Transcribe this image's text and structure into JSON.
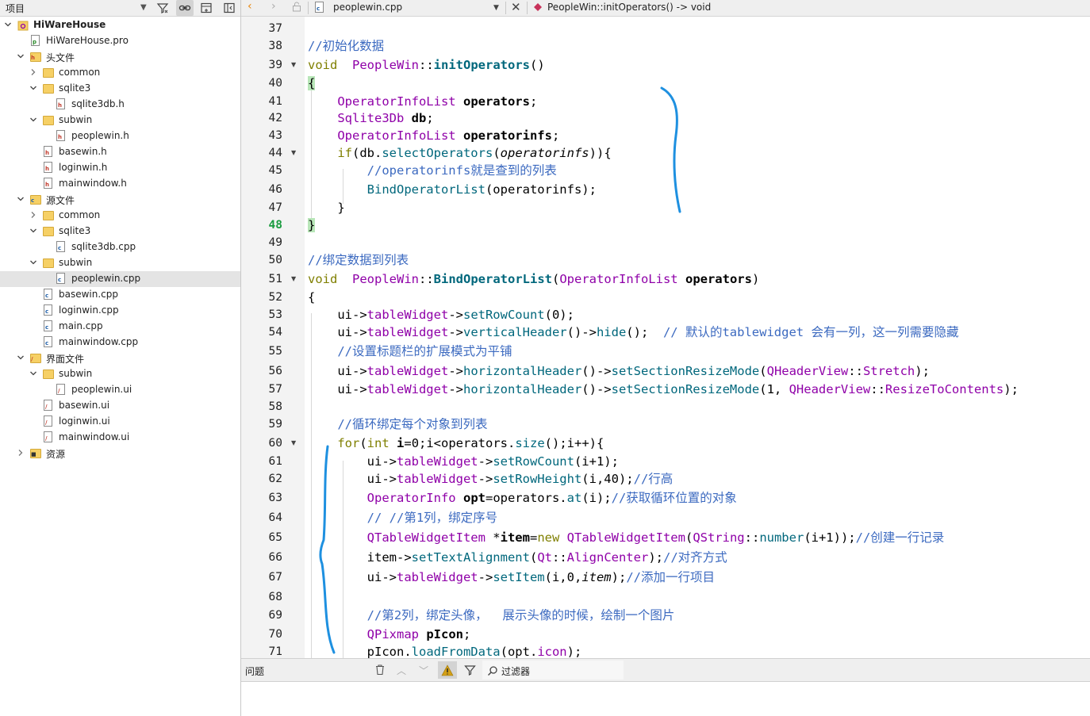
{
  "project_pane": {
    "combo_label": "项目",
    "tree": [
      {
        "label": "HiWareHouse",
        "depth": 0,
        "expander": "expanded",
        "icon": "project-icon",
        "root": true
      },
      {
        "label": "HiWareHouse.pro",
        "depth": 1,
        "expander": "none",
        "icon": "pro-file-icon"
      },
      {
        "label": "头文件",
        "depth": 1,
        "expander": "expanded",
        "icon": "headers-folder-icon"
      },
      {
        "label": "common",
        "depth": 2,
        "expander": "collapsed",
        "icon": "folder-icon"
      },
      {
        "label": "sqlite3",
        "depth": 2,
        "expander": "expanded",
        "icon": "folder-icon"
      },
      {
        "label": "sqlite3db.h",
        "depth": 3,
        "expander": "none",
        "icon": "header-file-icon"
      },
      {
        "label": "subwin",
        "depth": 2,
        "expander": "expanded",
        "icon": "folder-icon"
      },
      {
        "label": "peoplewin.h",
        "depth": 3,
        "expander": "none",
        "icon": "header-file-icon"
      },
      {
        "label": "basewin.h",
        "depth": 2,
        "expander": "none",
        "icon": "header-file-icon"
      },
      {
        "label": "loginwin.h",
        "depth": 2,
        "expander": "none",
        "icon": "header-file-icon"
      },
      {
        "label": "mainwindow.h",
        "depth": 2,
        "expander": "none",
        "icon": "header-file-icon"
      },
      {
        "label": "源文件",
        "depth": 1,
        "expander": "expanded",
        "icon": "sources-folder-icon"
      },
      {
        "label": "common",
        "depth": 2,
        "expander": "collapsed",
        "icon": "folder-icon"
      },
      {
        "label": "sqlite3",
        "depth": 2,
        "expander": "expanded",
        "icon": "folder-icon"
      },
      {
        "label": "sqlite3db.cpp",
        "depth": 3,
        "expander": "none",
        "icon": "cpp-file-icon"
      },
      {
        "label": "subwin",
        "depth": 2,
        "expander": "expanded",
        "icon": "folder-icon"
      },
      {
        "label": "peoplewin.cpp",
        "depth": 3,
        "expander": "none",
        "icon": "cpp-file-icon",
        "selected": true
      },
      {
        "label": "basewin.cpp",
        "depth": 2,
        "expander": "none",
        "icon": "cpp-file-icon"
      },
      {
        "label": "loginwin.cpp",
        "depth": 2,
        "expander": "none",
        "icon": "cpp-file-icon"
      },
      {
        "label": "main.cpp",
        "depth": 2,
        "expander": "none",
        "icon": "cpp-file-icon"
      },
      {
        "label": "mainwindow.cpp",
        "depth": 2,
        "expander": "none",
        "icon": "cpp-file-icon"
      },
      {
        "label": "界面文件",
        "depth": 1,
        "expander": "expanded",
        "icon": "forms-folder-icon"
      },
      {
        "label": "subwin",
        "depth": 2,
        "expander": "expanded",
        "icon": "folder-icon"
      },
      {
        "label": "peoplewin.ui",
        "depth": 3,
        "expander": "none",
        "icon": "ui-file-icon"
      },
      {
        "label": "basewin.ui",
        "depth": 2,
        "expander": "none",
        "icon": "ui-file-icon"
      },
      {
        "label": "loginwin.ui",
        "depth": 2,
        "expander": "none",
        "icon": "ui-file-icon"
      },
      {
        "label": "mainwindow.ui",
        "depth": 2,
        "expander": "none",
        "icon": "ui-file-icon"
      },
      {
        "label": "资源",
        "depth": 1,
        "expander": "collapsed",
        "icon": "resources-folder-icon"
      }
    ]
  },
  "editor_toolbar": {
    "file_name": "peoplewin.cpp",
    "symbol": "PeopleWin::initOperators() -> void"
  },
  "editor": {
    "current_line": 48,
    "lines": [
      {
        "n": 37,
        "tokens": []
      },
      {
        "n": 38,
        "tokens": [
          [
            "cm",
            "//初始化数据"
          ]
        ]
      },
      {
        "n": 39,
        "fold": true,
        "tokens": [
          [
            "kw",
            "void"
          ],
          [
            "",
            "  "
          ],
          [
            "ty",
            "PeopleWin"
          ],
          [
            "",
            "::"
          ],
          [
            "fnb",
            "initOperators"
          ],
          [
            "",
            "()"
          ]
        ]
      },
      {
        "n": 40,
        "tokens": [
          [
            "hl",
            "{"
          ]
        ]
      },
      {
        "n": 41,
        "tokens": [
          [
            "",
            "    "
          ],
          [
            "ty",
            "OperatorInfoList"
          ],
          [
            "",
            " "
          ],
          [
            "bd",
            "operators"
          ],
          [
            "",
            ";"
          ]
        ]
      },
      {
        "n": 42,
        "tokens": [
          [
            "",
            "    "
          ],
          [
            "ty",
            "Sqlite3Db"
          ],
          [
            "",
            " "
          ],
          [
            "bd",
            "db"
          ],
          [
            "",
            ";"
          ]
        ]
      },
      {
        "n": 43,
        "tokens": [
          [
            "",
            "    "
          ],
          [
            "ty",
            "OperatorInfoList"
          ],
          [
            "",
            " "
          ],
          [
            "bd",
            "operatorinfs"
          ],
          [
            "",
            ";"
          ]
        ]
      },
      {
        "n": 44,
        "fold": true,
        "tokens": [
          [
            "",
            "    "
          ],
          [
            "kw",
            "if"
          ],
          [
            "",
            "(db."
          ],
          [
            "fn",
            "selectOperators"
          ],
          [
            "",
            "("
          ],
          [
            "it",
            "operatorinfs"
          ],
          [
            "",
            "))"
          ],
          [
            "",
            "{"
          ]
        ]
      },
      {
        "n": 45,
        "tokens": [
          [
            "",
            "        "
          ],
          [
            "cm",
            "//operatorinfs就是查到的列表"
          ]
        ]
      },
      {
        "n": 46,
        "tokens": [
          [
            "",
            "        "
          ],
          [
            "fn",
            "BindOperatorList"
          ],
          [
            "",
            "(operatorinfs);"
          ]
        ]
      },
      {
        "n": 47,
        "tokens": [
          [
            "",
            "    }"
          ]
        ]
      },
      {
        "n": 48,
        "tokens": [
          [
            "hl",
            "}"
          ]
        ]
      },
      {
        "n": 49,
        "tokens": []
      },
      {
        "n": 50,
        "tokens": [
          [
            "cm",
            "//绑定数据到列表"
          ]
        ]
      },
      {
        "n": 51,
        "fold": true,
        "tokens": [
          [
            "kw",
            "void"
          ],
          [
            "",
            "  "
          ],
          [
            "ty",
            "PeopleWin"
          ],
          [
            "",
            "::"
          ],
          [
            "fnb",
            "BindOperatorList"
          ],
          [
            "",
            "("
          ],
          [
            "ty",
            "OperatorInfoList"
          ],
          [
            "",
            " "
          ],
          [
            "bd",
            "operators"
          ],
          [
            "",
            ")"
          ]
        ]
      },
      {
        "n": 52,
        "tokens": [
          [
            "",
            "{"
          ]
        ]
      },
      {
        "n": 53,
        "tokens": [
          [
            "",
            "    ui->"
          ],
          [
            "ty",
            "tableWidget"
          ],
          [
            "",
            "->"
          ],
          [
            "fn",
            "setRowCount"
          ],
          [
            "",
            "(0);"
          ]
        ]
      },
      {
        "n": 54,
        "tokens": [
          [
            "",
            "    ui->"
          ],
          [
            "ty",
            "tableWidget"
          ],
          [
            "",
            "->"
          ],
          [
            "fn",
            "verticalHeader"
          ],
          [
            "",
            "()->"
          ],
          [
            "fn",
            "hide"
          ],
          [
            "",
            "();  "
          ],
          [
            "cm",
            "// 默认的tablewidget 会有一列，这一列需要隐藏"
          ]
        ]
      },
      {
        "n": 55,
        "tokens": [
          [
            "",
            "    "
          ],
          [
            "cm",
            "//设置标题栏的扩展模式为平铺"
          ]
        ]
      },
      {
        "n": 56,
        "tokens": [
          [
            "",
            "    ui->"
          ],
          [
            "ty",
            "tableWidget"
          ],
          [
            "",
            "->"
          ],
          [
            "fn",
            "horizontalHeader"
          ],
          [
            "",
            "()->"
          ],
          [
            "fn",
            "setSectionResizeMode"
          ],
          [
            "",
            "("
          ],
          [
            "ty",
            "QHeaderView"
          ],
          [
            "",
            "::"
          ],
          [
            "ty",
            "Stretch"
          ],
          [
            "",
            ");"
          ]
        ]
      },
      {
        "n": 57,
        "tokens": [
          [
            "",
            "    ui->"
          ],
          [
            "ty",
            "tableWidget"
          ],
          [
            "",
            "->"
          ],
          [
            "fn",
            "horizontalHeader"
          ],
          [
            "",
            "()->"
          ],
          [
            "fn",
            "setSectionResizeMode"
          ],
          [
            "",
            "(1, "
          ],
          [
            "ty",
            "QHeaderView"
          ],
          [
            "",
            "::"
          ],
          [
            "ty",
            "ResizeToContents"
          ],
          [
            "",
            ");"
          ]
        ]
      },
      {
        "n": 58,
        "tokens": []
      },
      {
        "n": 59,
        "tokens": [
          [
            "",
            "    "
          ],
          [
            "cm",
            "//循环绑定每个对象到列表"
          ]
        ]
      },
      {
        "n": 60,
        "fold": true,
        "tokens": [
          [
            "",
            "    "
          ],
          [
            "kw",
            "for"
          ],
          [
            "",
            "("
          ],
          [
            "kw",
            "int"
          ],
          [
            "",
            " "
          ],
          [
            "bd",
            "i"
          ],
          [
            "",
            "=0;i<operators."
          ],
          [
            "fn",
            "size"
          ],
          [
            "",
            "();i++){"
          ]
        ]
      },
      {
        "n": 61,
        "tokens": [
          [
            "",
            "        ui->"
          ],
          [
            "ty",
            "tableWidget"
          ],
          [
            "",
            "->"
          ],
          [
            "fn",
            "setRowCount"
          ],
          [
            "",
            "(i+1);"
          ]
        ]
      },
      {
        "n": 62,
        "tokens": [
          [
            "",
            "        ui->"
          ],
          [
            "ty",
            "tableWidget"
          ],
          [
            "",
            "->"
          ],
          [
            "fn",
            "setRowHeight"
          ],
          [
            "",
            "(i,40);"
          ],
          [
            "cm",
            "//行高"
          ]
        ]
      },
      {
        "n": 63,
        "tokens": [
          [
            "",
            "        "
          ],
          [
            "ty",
            "OperatorInfo"
          ],
          [
            "",
            " "
          ],
          [
            "bd",
            "opt"
          ],
          [
            "",
            "=operators."
          ],
          [
            "fn",
            "at"
          ],
          [
            "",
            "(i);"
          ],
          [
            "cm",
            "//获取循环位置的对象"
          ]
        ]
      },
      {
        "n": 64,
        "tokens": [
          [
            "",
            "        "
          ],
          [
            "cm",
            "// //第1列，绑定序号"
          ]
        ]
      },
      {
        "n": 65,
        "tokens": [
          [
            "",
            "        "
          ],
          [
            "ty",
            "QTableWidgetItem"
          ],
          [
            "",
            " *"
          ],
          [
            "bd",
            "item"
          ],
          [
            "",
            "="
          ],
          [
            "kw",
            "new"
          ],
          [
            "",
            " "
          ],
          [
            "ty",
            "QTableWidgetItem"
          ],
          [
            "",
            "("
          ],
          [
            "ty",
            "QString"
          ],
          [
            "",
            "::"
          ],
          [
            "fn",
            "number"
          ],
          [
            "",
            "(i+1));"
          ],
          [
            "cm",
            "//创建一行记录"
          ]
        ]
      },
      {
        "n": 66,
        "tokens": [
          [
            "",
            "        item->"
          ],
          [
            "fn",
            "setTextAlignment"
          ],
          [
            "",
            "("
          ],
          [
            "ty",
            "Qt"
          ],
          [
            "",
            "::"
          ],
          [
            "ty",
            "AlignCenter"
          ],
          [
            "",
            ");"
          ],
          [
            "cm",
            "//对齐方式"
          ]
        ]
      },
      {
        "n": 67,
        "tokens": [
          [
            "",
            "        ui->"
          ],
          [
            "ty",
            "tableWidget"
          ],
          [
            "",
            "->"
          ],
          [
            "fn",
            "setItem"
          ],
          [
            "",
            "(i,0,"
          ],
          [
            "it",
            "item"
          ],
          [
            "",
            ");"
          ],
          [
            "cm",
            "//添加一行项目"
          ]
        ]
      },
      {
        "n": 68,
        "tokens": []
      },
      {
        "n": 69,
        "tokens": [
          [
            "",
            "        "
          ],
          [
            "cm",
            "//第2列，绑定头像，  展示头像的时候，绘制一个图片"
          ]
        ]
      },
      {
        "n": 70,
        "tokens": [
          [
            "",
            "        "
          ],
          [
            "ty",
            "QPixmap"
          ],
          [
            "",
            " "
          ],
          [
            "bd",
            "pIcon"
          ],
          [
            "",
            ";"
          ]
        ]
      },
      {
        "n": 71,
        "tokens": [
          [
            "",
            "        pIcon."
          ],
          [
            "fn",
            "loadFromData"
          ],
          [
            "",
            "(opt."
          ],
          [
            "ty",
            "icon"
          ],
          [
            "",
            ");"
          ]
        ]
      }
    ]
  },
  "issues_pane": {
    "title": "问题",
    "filter_placeholder": "过滤器"
  },
  "colors": {
    "annotation_stroke": "#1e90e0",
    "current_line_number": "#1a9b3f",
    "comment": "#3c6ac0",
    "keyword": "#7f7f00",
    "type": "#8f00a8",
    "function": "#00677c"
  }
}
